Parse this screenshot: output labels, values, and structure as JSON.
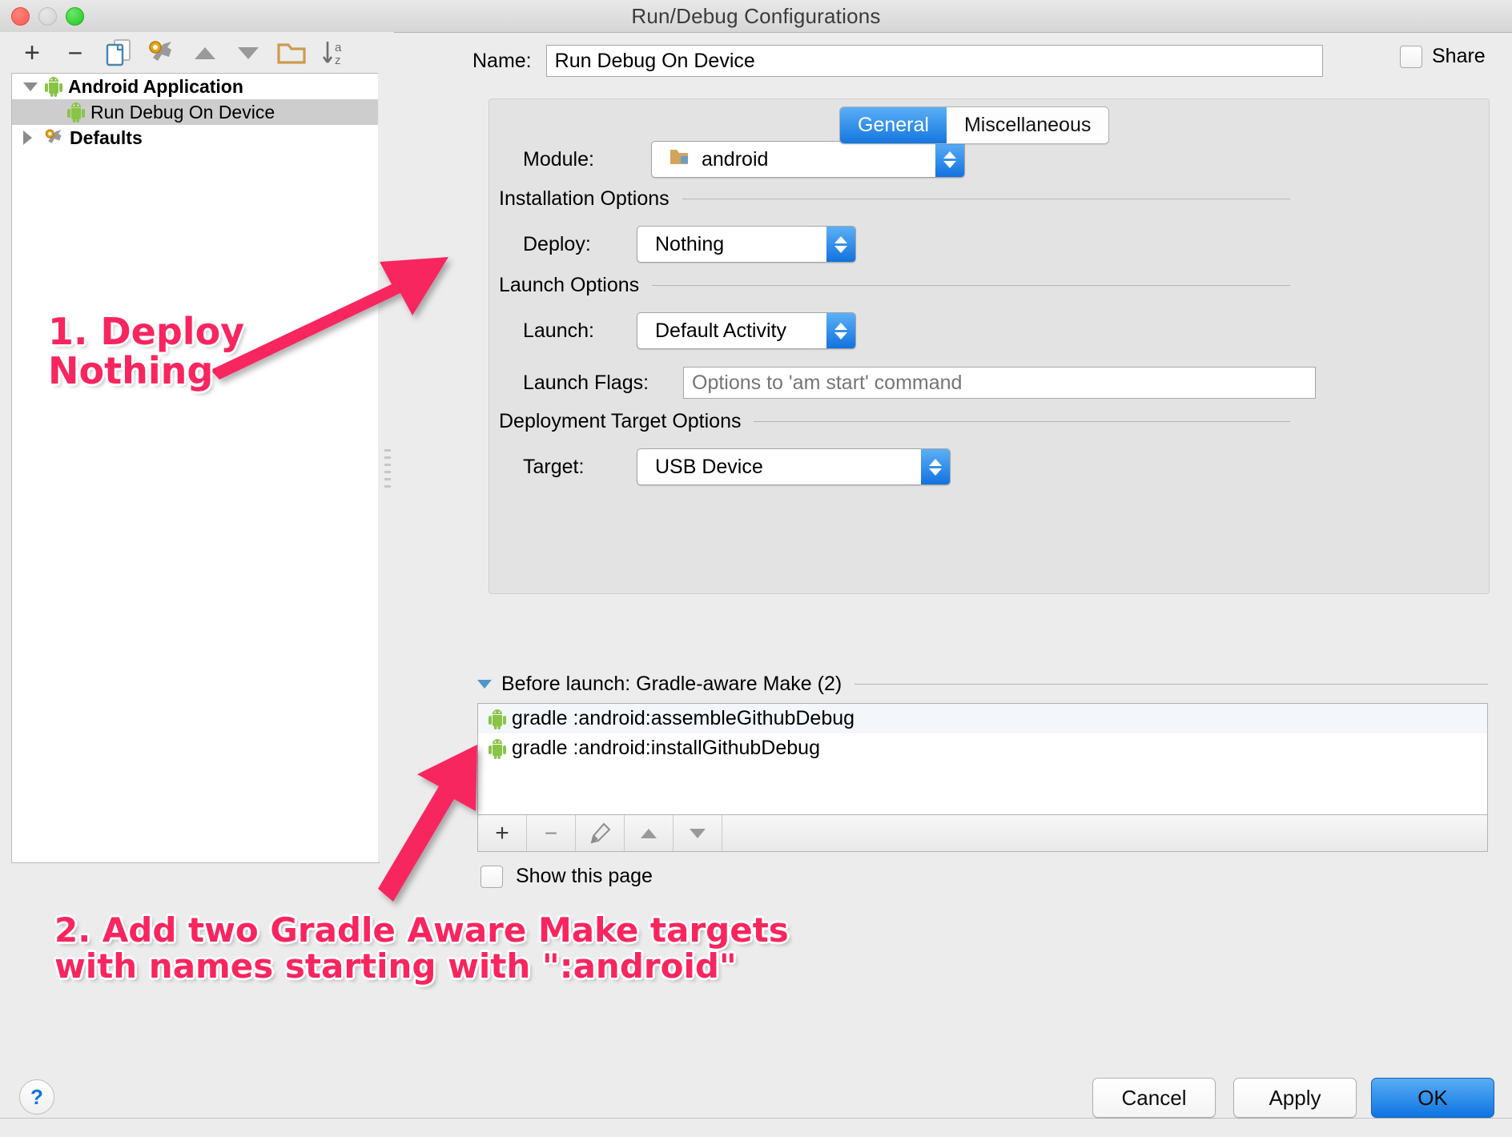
{
  "window": {
    "title": "Run/Debug Configurations",
    "traffic_lights": [
      "close-red",
      "minimize-gray",
      "zoom-green"
    ]
  },
  "left_toolbar": {
    "buttons": [
      {
        "name": "add",
        "icon": "plus-icon",
        "label": "+"
      },
      {
        "name": "remove",
        "icon": "minus-icon",
        "label": "−"
      },
      {
        "name": "copy",
        "icon": "copy-configuration-icon",
        "label": ""
      },
      {
        "name": "edit-defaults",
        "icon": "wrench-icon",
        "label": ""
      },
      {
        "name": "move-up",
        "icon": "triangle-up-icon",
        "label": ""
      },
      {
        "name": "move-down",
        "icon": "triangle-down-icon",
        "label": ""
      },
      {
        "name": "new-folder",
        "icon": "folder-icon",
        "label": ""
      },
      {
        "name": "sort-alphabetically",
        "icon": "sort-az-icon",
        "label": ""
      }
    ]
  },
  "tree": {
    "items": [
      {
        "label": "Android Application",
        "icon": "android-icon",
        "expanded": true,
        "bold": true,
        "selected": false,
        "level": 0
      },
      {
        "label": "Run Debug On Device",
        "icon": "android-icon",
        "expanded": null,
        "bold": false,
        "selected": true,
        "level": 1
      },
      {
        "label": "Defaults",
        "icon": "wrench-icon",
        "expanded": false,
        "bold": true,
        "selected": false,
        "level": 0
      }
    ]
  },
  "name_field": {
    "label": "Name:",
    "value": "Run Debug On Device",
    "placeholder": ""
  },
  "share": {
    "label": "Share",
    "checked": false
  },
  "tabs": [
    {
      "label": "General",
      "active": true
    },
    {
      "label": "Miscellaneous",
      "active": false
    }
  ],
  "general": {
    "module": {
      "label": "Module:",
      "value": "android",
      "icon": "module-folder-icon"
    },
    "installation_options": {
      "section_label": "Installation Options",
      "deploy": {
        "label": "Deploy:",
        "value": "Nothing"
      }
    },
    "launch_options": {
      "section_label": "Launch Options",
      "launch": {
        "label": "Launch:",
        "value": "Default Activity"
      },
      "launch_flags": {
        "label": "Launch Flags:",
        "value": "",
        "placeholder": "Options to 'am start' command"
      }
    },
    "deployment_target_options": {
      "section_label": "Deployment Target Options",
      "target": {
        "label": "Target:",
        "value": "USB Device"
      }
    }
  },
  "before_launch": {
    "title": "Before launch: Gradle-aware Make (2)",
    "expanded": true,
    "tasks": [
      {
        "icon": "android-icon",
        "label": "gradle :android:assembleGithubDebug"
      },
      {
        "icon": "android-icon",
        "label": "gradle :android:installGithubDebug"
      }
    ],
    "toolbar": [
      {
        "name": "add-task",
        "icon": "plus-icon",
        "label": "+"
      },
      {
        "name": "remove-task",
        "icon": "minus-icon",
        "label": "−"
      },
      {
        "name": "edit-task",
        "icon": "pencil-icon",
        "label": ""
      },
      {
        "name": "move-task-up",
        "icon": "triangle-up-icon",
        "label": ""
      },
      {
        "name": "move-task-down",
        "icon": "triangle-down-icon",
        "label": ""
      }
    ],
    "show_this_page": {
      "label": "Show this page",
      "checked": false
    }
  },
  "footer": {
    "help": "?",
    "cancel": "Cancel",
    "apply": "Apply",
    "ok": "OK"
  },
  "annotations": [
    {
      "id": "anno1",
      "text": "1. Deploy\nNothing",
      "color": "#f8255f"
    },
    {
      "id": "anno2",
      "text": "2. Add two Gradle Aware Make targets\nwith names starting with \":android\"",
      "color": "#f8255f"
    }
  ],
  "colors": {
    "accent_blue": "#1477e0",
    "annotation_pink": "#f8255f",
    "window_bg": "#ececec",
    "panel_bg": "#e3e3e3",
    "android_green": "#7bb442"
  }
}
